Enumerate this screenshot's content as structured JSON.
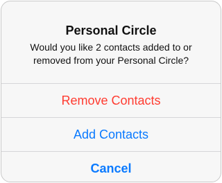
{
  "alert": {
    "title": "Personal Circle",
    "message": "Would you like 2 contacts added to or removed from your Personal Circle?",
    "actions": [
      {
        "label": "Remove Contacts",
        "color": "#ff3b30"
      },
      {
        "label": "Add Contacts",
        "color": "#0a7aff"
      },
      {
        "label": "Cancel",
        "color": "#0a7aff"
      }
    ]
  }
}
